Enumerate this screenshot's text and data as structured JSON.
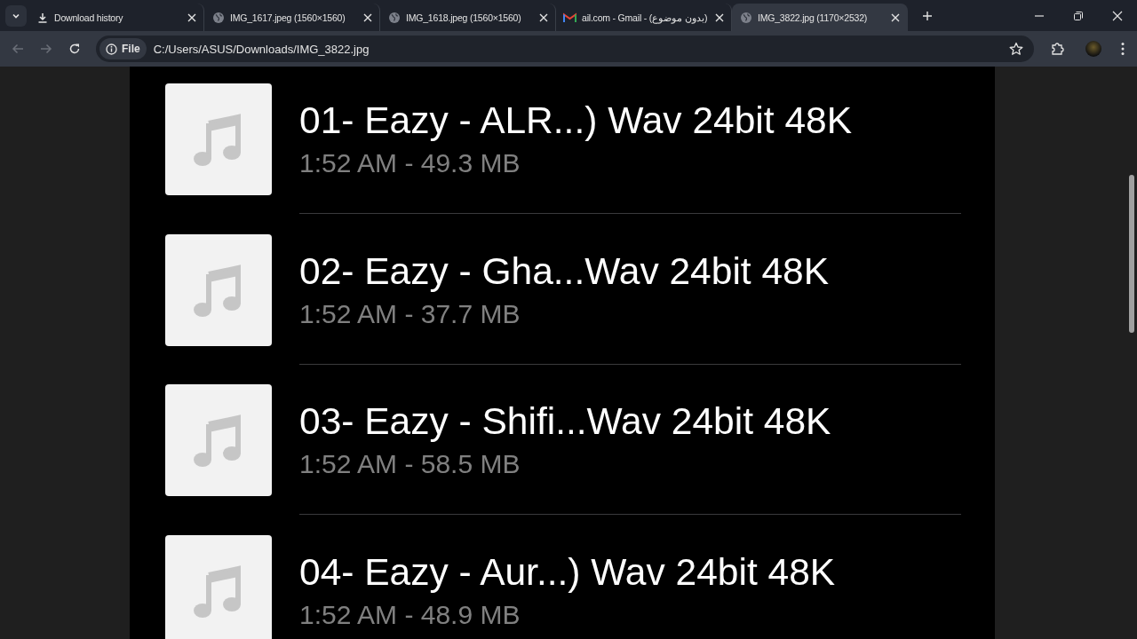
{
  "tabs": [
    {
      "kind": "download",
      "title": "Download history",
      "selected": false
    },
    {
      "kind": "globe",
      "title": "IMG_1617.jpeg (1560×1560)",
      "selected": false
    },
    {
      "kind": "globe",
      "title": "IMG_1618.jpeg (1560×1560)",
      "selected": false
    },
    {
      "kind": "mail",
      "title": "ail.com - Gmail - (بدون موضوع)",
      "selected": false
    },
    {
      "kind": "globe",
      "title": "IMG_3822.jpg (1170×2532)",
      "selected": true
    }
  ],
  "address_bar": {
    "scheme_chip": "File",
    "url": "C:/Users/ASUS/Downloads/IMG_3822.jpg"
  },
  "files": [
    {
      "title": "01- Eazy - ALR...) Wav 24bit 48K",
      "meta": "1:52 AM - 49.3 MB"
    },
    {
      "title": "02- Eazy - Gha...Wav 24bit 48K",
      "meta": "1:52 AM - 37.7 MB"
    },
    {
      "title": "03- Eazy - Shifi...Wav 24bit 48K",
      "meta": "1:52 AM - 58.5 MB"
    },
    {
      "title": "04- Eazy - Aur...) Wav 24bit 48K",
      "meta": "1:52 AM - 48.9 MB"
    }
  ]
}
